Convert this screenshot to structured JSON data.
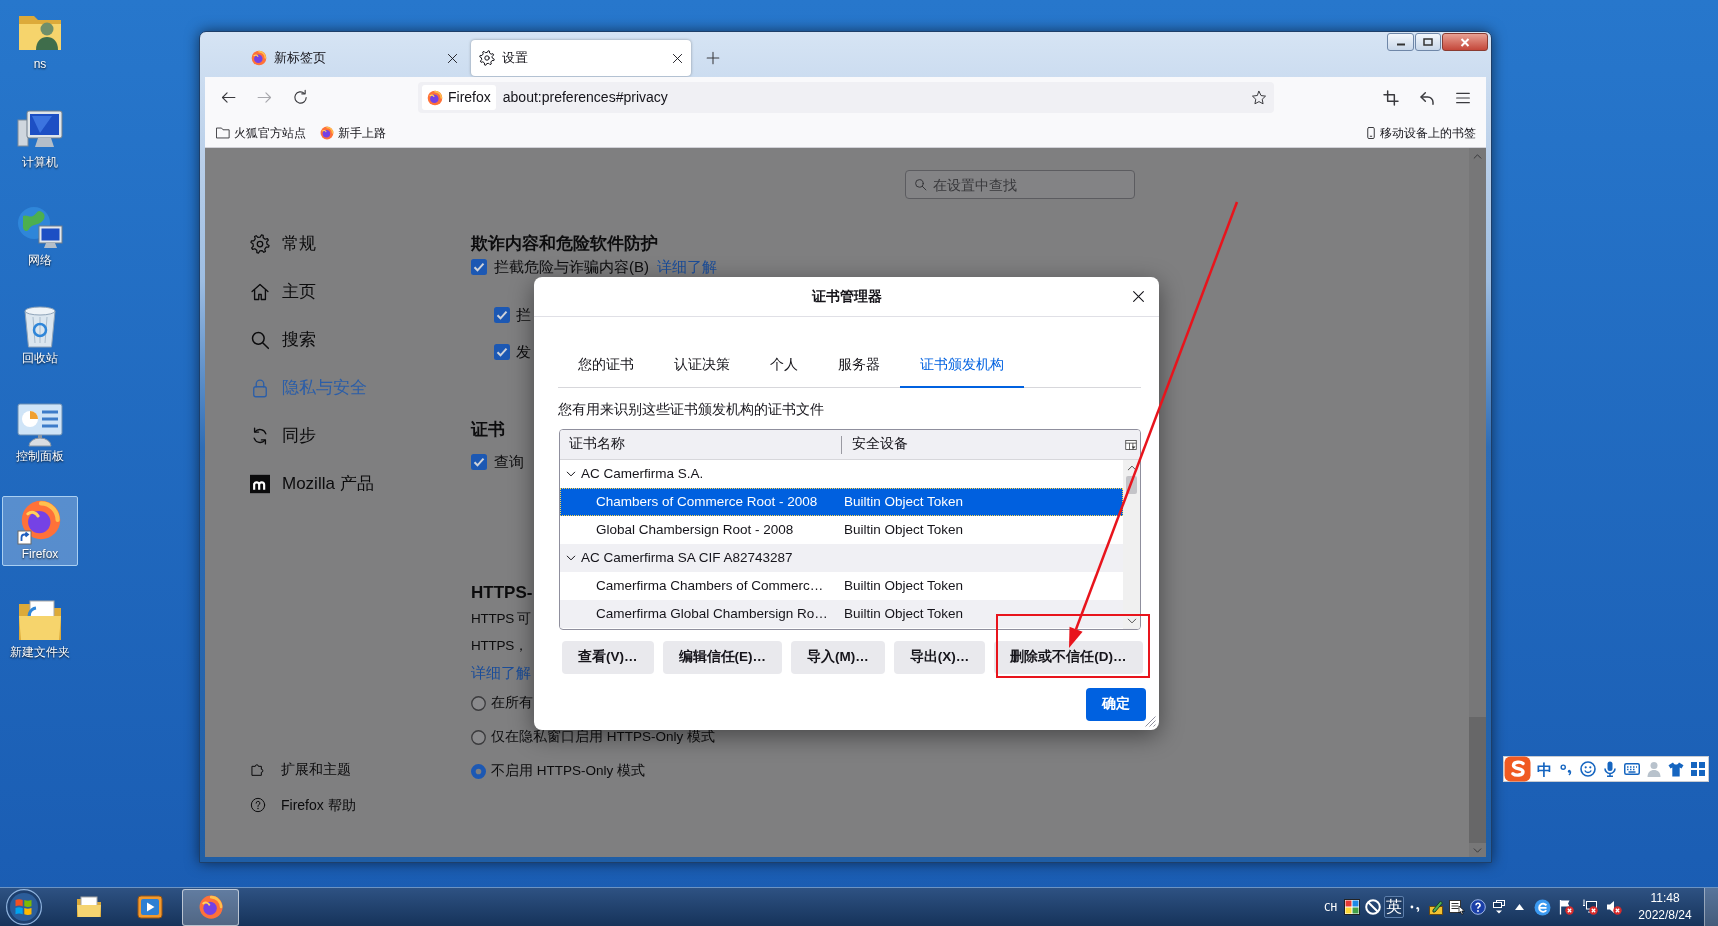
{
  "desktop": {
    "icons": [
      {
        "label": "ns",
        "kind": "user",
        "selected": false
      },
      {
        "label": "计算机",
        "kind": "computer",
        "selected": false
      },
      {
        "label": "网络",
        "kind": "network",
        "selected": false
      },
      {
        "label": "回收站",
        "kind": "bin",
        "selected": false
      },
      {
        "label": "控制面板",
        "kind": "panel",
        "selected": false
      },
      {
        "label": "Firefox",
        "kind": "firefox",
        "selected": true
      },
      {
        "label": "新建文件夹",
        "kind": "folder",
        "selected": false
      }
    ]
  },
  "browser": {
    "tabs": [
      {
        "title": "新标签页",
        "kind": "firefox",
        "selected": false
      },
      {
        "title": "设置",
        "kind": "gear",
        "selected": true
      }
    ],
    "navigation": [
      {
        "kind": "back",
        "disabled": false
      },
      {
        "kind": "forward",
        "disabled": true
      },
      {
        "kind": "reload",
        "disabled": false
      }
    ],
    "identity": "Firefox",
    "url": "about:preferences#privacy",
    "bookmarks": [
      {
        "label": "火狐官方站点",
        "kind": "folder"
      },
      {
        "label": "新手上路",
        "kind": "firefox"
      }
    ],
    "mobile_bookmarks": "移动设备上的书签",
    "search": {
      "placeholder": "在设置中查找"
    },
    "sidebar": {
      "categories": [
        {
          "label": "常规",
          "kind": "gear",
          "selected": false
        },
        {
          "label": "主页",
          "kind": "home",
          "selected": false
        },
        {
          "label": "搜索",
          "kind": "search",
          "selected": false
        },
        {
          "label": "隐私与安全",
          "kind": "lock",
          "selected": true
        },
        {
          "label": "同步",
          "kind": "sync",
          "selected": false
        },
        {
          "label": "Mozilla 产品",
          "kind": "mozilla",
          "selected": false
        }
      ],
      "footer": [
        {
          "label": "扩展和主题",
          "kind": "puzzle"
        },
        {
          "label": "Firefox 帮助",
          "kind": "help"
        }
      ]
    },
    "sections": [
      {
        "heading": "欺诈内容和危险软件防护",
        "items": [
          {
            "kind": "checkbox",
            "label": "拦截危险与诈骗内容(B)",
            "link": "详细了解",
            "checked": true,
            "children": [
              {
                "kind": "checkbox",
                "label": "拦",
                "checked": true
              },
              {
                "kind": "checkbox",
                "label": "发",
                "checked": true
              }
            ]
          }
        ]
      },
      {
        "heading": "证书",
        "items": [
          {
            "kind": "checkbox",
            "label": "查询",
            "checked": true
          }
        ]
      },
      {
        "heading": "HTTPS-",
        "items": [
          {
            "kind": "text",
            "label": "HTTPS 可"
          },
          {
            "kind": "text",
            "label": "HTTPS，"
          },
          {
            "kind": "link",
            "label": "详细了解"
          },
          {
            "kind": "radio",
            "label": "在所有",
            "selected": false
          },
          {
            "kind": "radio",
            "label": "仅在隐私窗口启用 HTTPS-Only 模式",
            "selected": false
          },
          {
            "kind": "radio",
            "label": "不启用 HTTPS-Only 模式",
            "selected": true
          }
        ]
      }
    ]
  },
  "dialog": {
    "title": "证书管理器",
    "tabs": [
      {
        "label": "您的证书",
        "selected": false
      },
      {
        "label": "认证决策",
        "selected": false
      },
      {
        "label": "个人",
        "selected": false
      },
      {
        "label": "服务器",
        "selected": false
      },
      {
        "label": "证书颁发机构",
        "selected": true
      }
    ],
    "description": "您有用来识别这些证书颁发机构的证书文件",
    "columns": [
      "证书名称",
      "安全设备"
    ],
    "rows": [
      {
        "name": "AC Camerfirma S.A.",
        "expanded": true,
        "selected": false,
        "children": [
          {
            "name": "Chambers of Commerce Root - 2008",
            "device": "Builtin Object Token",
            "selected": true
          },
          {
            "name": "Global Chambersign Root - 2008",
            "device": "Builtin Object Token",
            "selected": false
          }
        ]
      },
      {
        "name": "AC Camerfirma SA CIF A82743287",
        "expanded": true,
        "selected": false,
        "children": [
          {
            "name": "Camerfirma Chambers of Commerc…",
            "device": "Builtin Object Token",
            "selected": false
          },
          {
            "name": "Camerfirma Global Chambersign Ro…",
            "device": "Builtin Object Token",
            "selected": false
          }
        ]
      }
    ],
    "buttons": [
      "查看(V)…",
      "编辑信任(E)…",
      "导入(M)…",
      "导出(X)…",
      "删除或不信任(D)…"
    ],
    "confirm": "确定"
  },
  "ime_toolbar": {
    "mode": "中"
  },
  "taskbar": {
    "apps": [
      {
        "kind": "explorer",
        "selected": false
      },
      {
        "kind": "media",
        "selected": false
      },
      {
        "kind": "firefox",
        "selected": true
      }
    ],
    "language": "CH",
    "ime_mode": "英",
    "time": "11:48",
    "date": "2022/8/24"
  }
}
